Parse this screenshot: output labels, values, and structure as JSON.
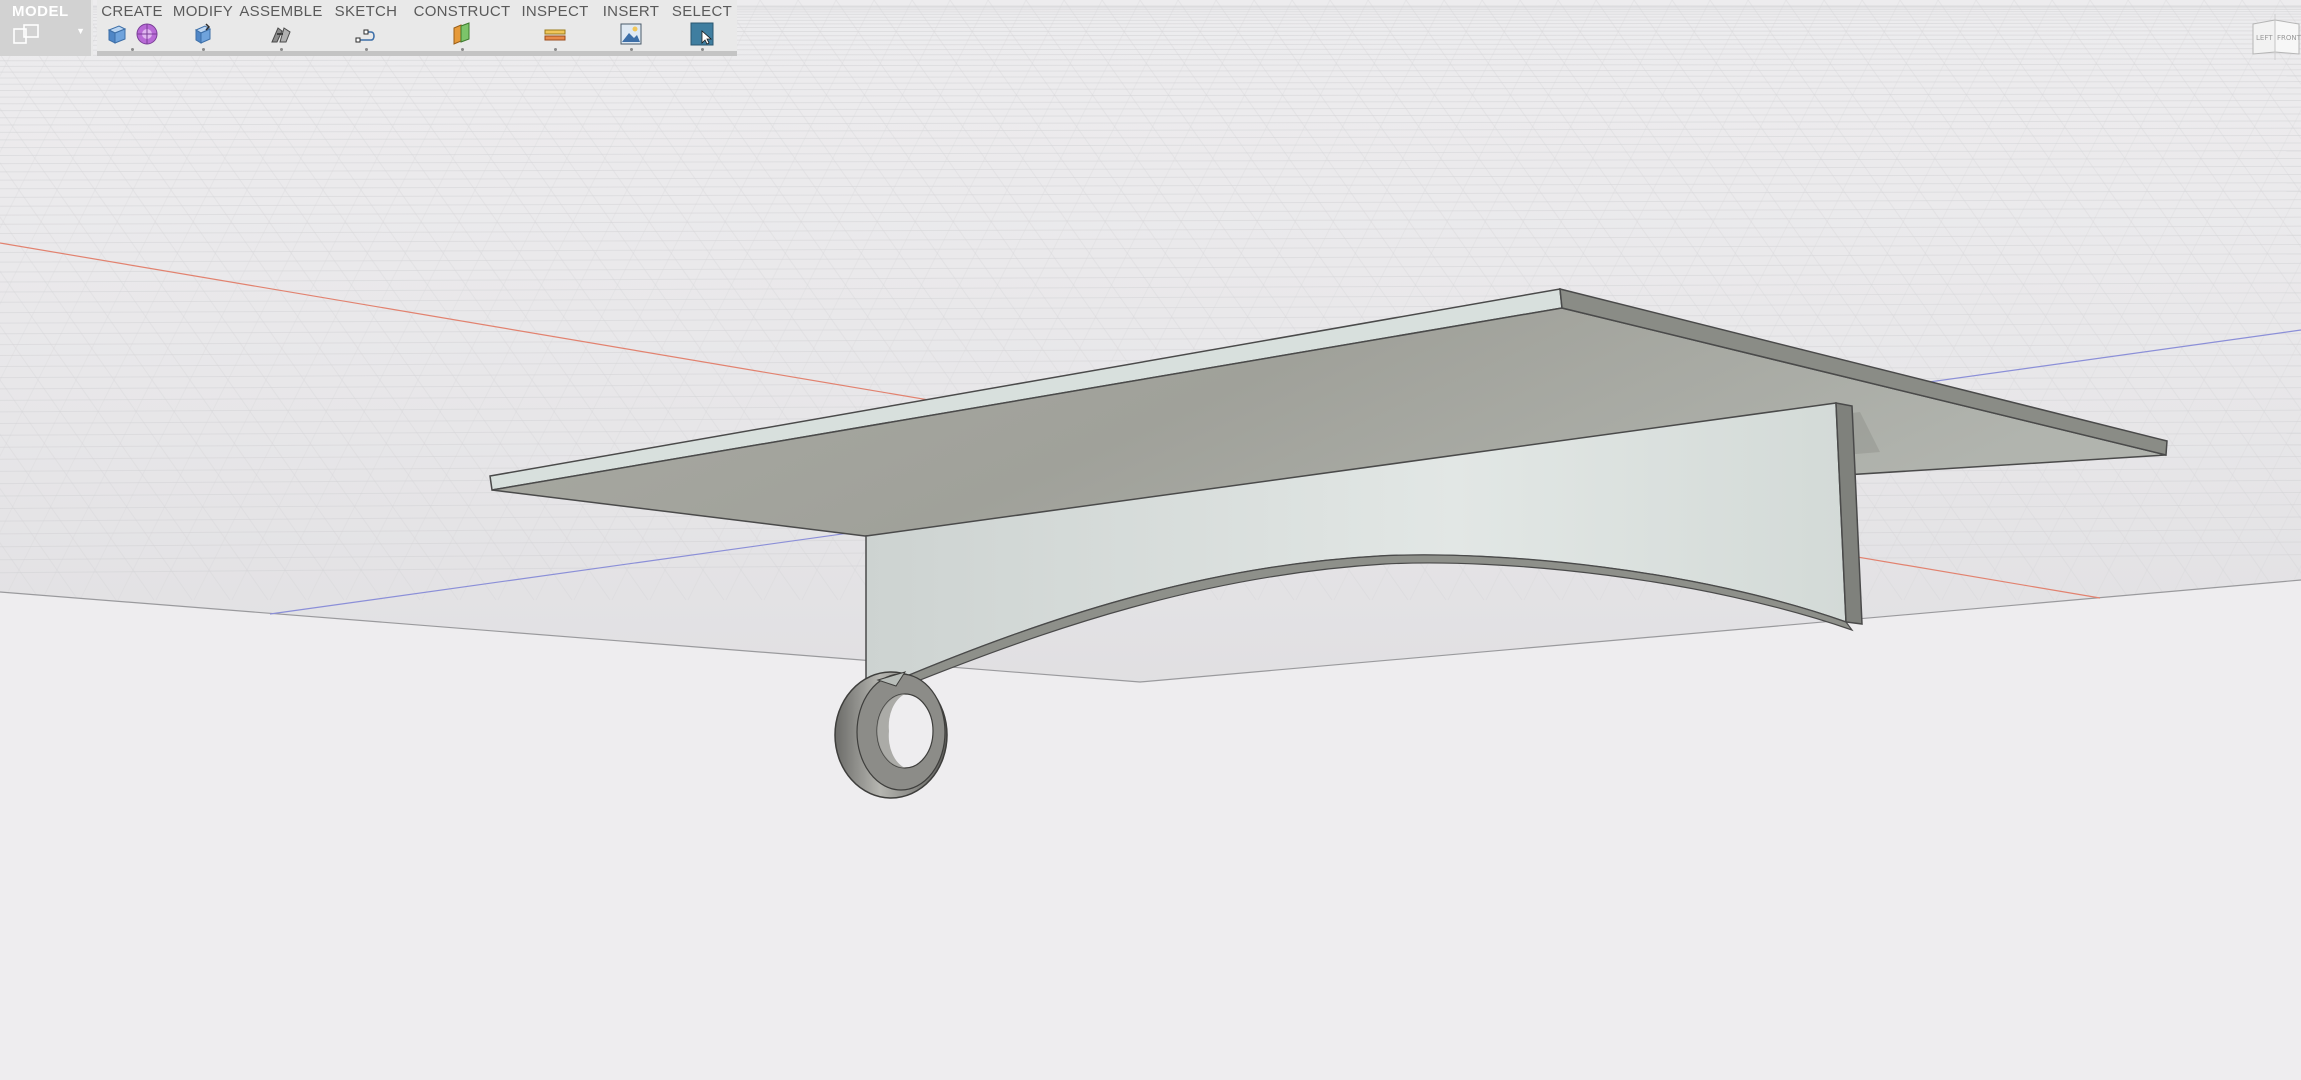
{
  "toolbar": {
    "workspace": {
      "label": "MODEL",
      "icon": "model-workspace-icon"
    },
    "groups": [
      {
        "label": "CREATE",
        "icons": [
          "extrude-box-icon",
          "sculpt-form-icon"
        ]
      },
      {
        "label": "MODIFY",
        "icons": [
          "press-pull-icon"
        ]
      },
      {
        "label": "ASSEMBLE",
        "icons": [
          "joint-icon"
        ]
      },
      {
        "label": "SKETCH",
        "icons": [
          "sketch-line-icon"
        ]
      },
      {
        "label": "CONSTRUCT",
        "icons": [
          "offset-plane-icon"
        ]
      },
      {
        "label": "INSPECT",
        "icons": [
          "measure-icon"
        ]
      },
      {
        "label": "INSERT",
        "icons": [
          "insert-image-icon"
        ]
      },
      {
        "label": "SELECT",
        "icons": [
          "select-icon"
        ]
      }
    ]
  },
  "viewcube": {
    "left_face": "LEFT",
    "front_face": "FRONT",
    "icon": "viewcube-icon"
  },
  "colors": {
    "background": "#eeedef",
    "grid_line": "#c8c8cc",
    "x_axis": "#e07a6a",
    "z_axis": "#8a8ad8",
    "model_face_top": "#a2a39c",
    "model_face_light": "#d2d9d6",
    "model_edge": "#4a4a4a"
  }
}
